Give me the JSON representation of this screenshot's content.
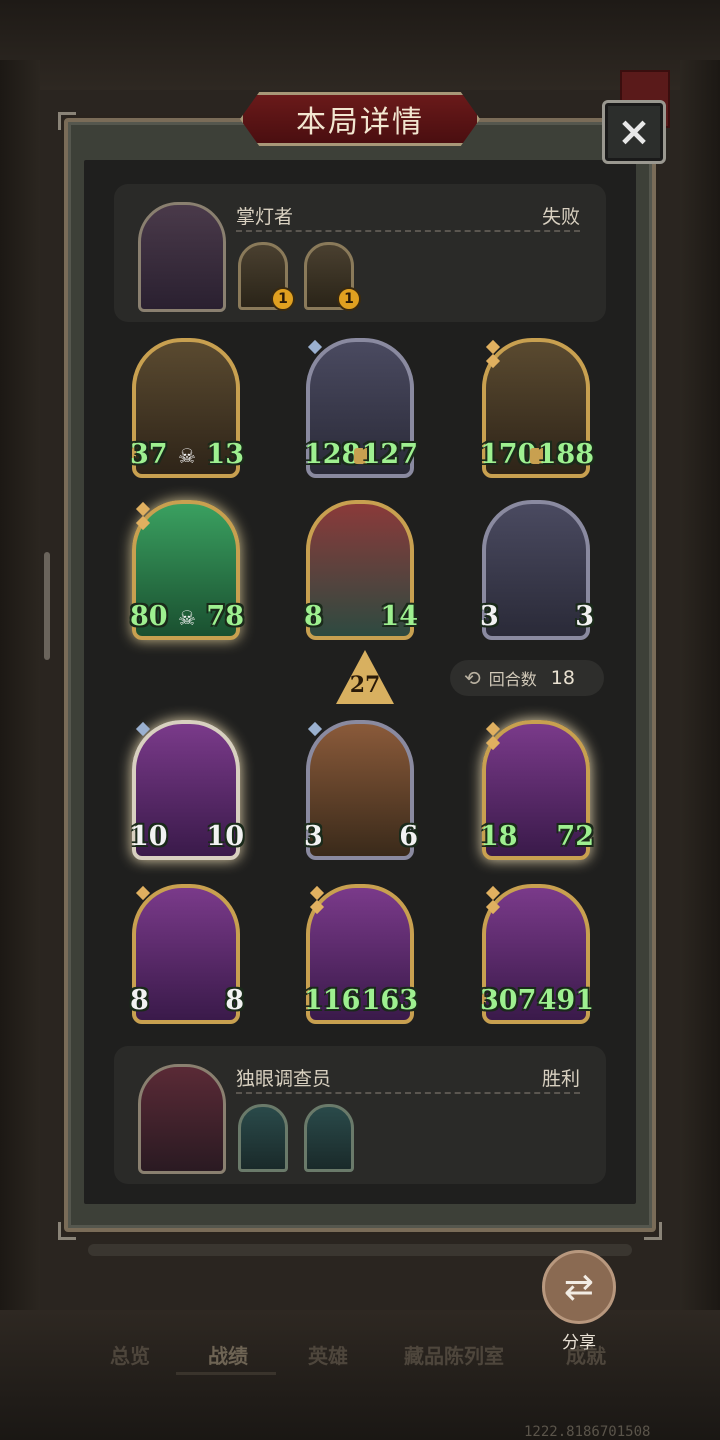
{
  "title": "本局详情",
  "close_icon": "×",
  "top_player": {
    "name": "掌灯者",
    "result": "失败",
    "items": [
      {
        "icon": "lantern-item-icon",
        "badge": "1"
      },
      {
        "icon": "masked-face-item-icon",
        "badge": "1"
      }
    ]
  },
  "bottom_player": {
    "name": "独眼调查员",
    "result": "胜利",
    "items": [
      {
        "icon": "blade-item-icon"
      },
      {
        "icon": "tea-set-item-icon"
      }
    ]
  },
  "top_board": [
    {
      "name": "ghost-priestess",
      "atk": "37",
      "hp": "13",
      "skull": true
    },
    {
      "name": "pumpkin-brute-1",
      "atk": "128",
      "hp": "127",
      "lock": true
    },
    {
      "name": "pumpkin-brute-2",
      "atk": "170",
      "hp": "188",
      "lock": true
    },
    {
      "name": "green-ghost-rogue",
      "atk": "80",
      "hp": "78",
      "skull": true
    },
    {
      "name": "red-haired-maiden",
      "atk": "8",
      "hp": "14"
    },
    {
      "name": "rocket-crate",
      "atk": "3",
      "hp": "3"
    }
  ],
  "bottom_board": [
    {
      "name": "swirl-pumpkin-1",
      "atk": "10",
      "hp": "10"
    },
    {
      "name": "tree-ent",
      "atk": "3",
      "hp": "6"
    },
    {
      "name": "stone-golem",
      "atk": "18",
      "hp": "72"
    },
    {
      "name": "cactus-creature",
      "atk": "8",
      "hp": "8"
    },
    {
      "name": "swirl-pumpkin-2",
      "atk": "116",
      "hp": "163"
    },
    {
      "name": "tiki-mask",
      "atk": "307",
      "hp": "491"
    }
  ],
  "level": "27",
  "round": {
    "label": "回合数",
    "value": "18",
    "icon": "repeat-icon"
  },
  "share": {
    "label": "分享",
    "icon": "share-icon"
  },
  "tabs": [
    "总览",
    "战绩",
    "英雄",
    "藏品陈列室",
    "成就"
  ],
  "version": "1222.8186701508",
  "colors": {
    "accent": "#c8a050",
    "stat": "#9ef090",
    "banner": "#6a1a1a"
  }
}
